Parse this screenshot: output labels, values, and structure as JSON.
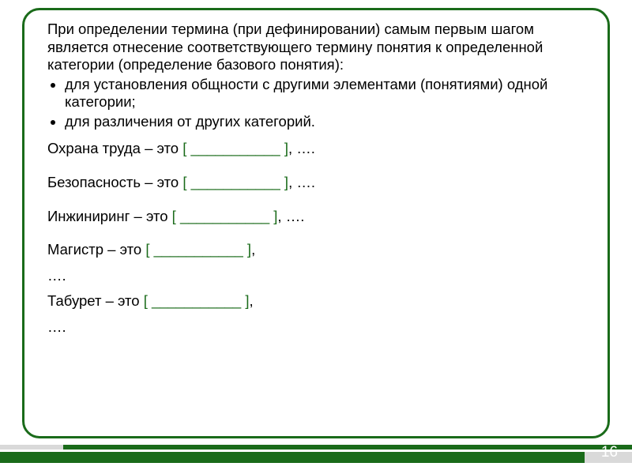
{
  "intro": "При определении термина (при дефинировании) самым первым шагом является отнесение соответствующего термину понятия к определенной категории (определение базового понятия):",
  "bullets": [
    "для установления общности с другими элементами (понятиями) одной категории;",
    "для различения от других категорий."
  ],
  "examples": [
    {
      "label": "Охрана труда",
      "tail": ", …."
    },
    {
      "label": "Безопасность",
      "tail": ", …."
    },
    {
      "label": "Инжиниринг",
      "tail": ", …."
    },
    {
      "label": "Магистр",
      "tail": ","
    },
    {
      "label": "Табурет",
      "tail": ","
    }
  ],
  "dash": " – это ",
  "bracket_open": "[ ",
  "blank": "___________",
  "bracket_close": "  ]",
  "ellipsis_line": "….",
  "page_number": "16"
}
